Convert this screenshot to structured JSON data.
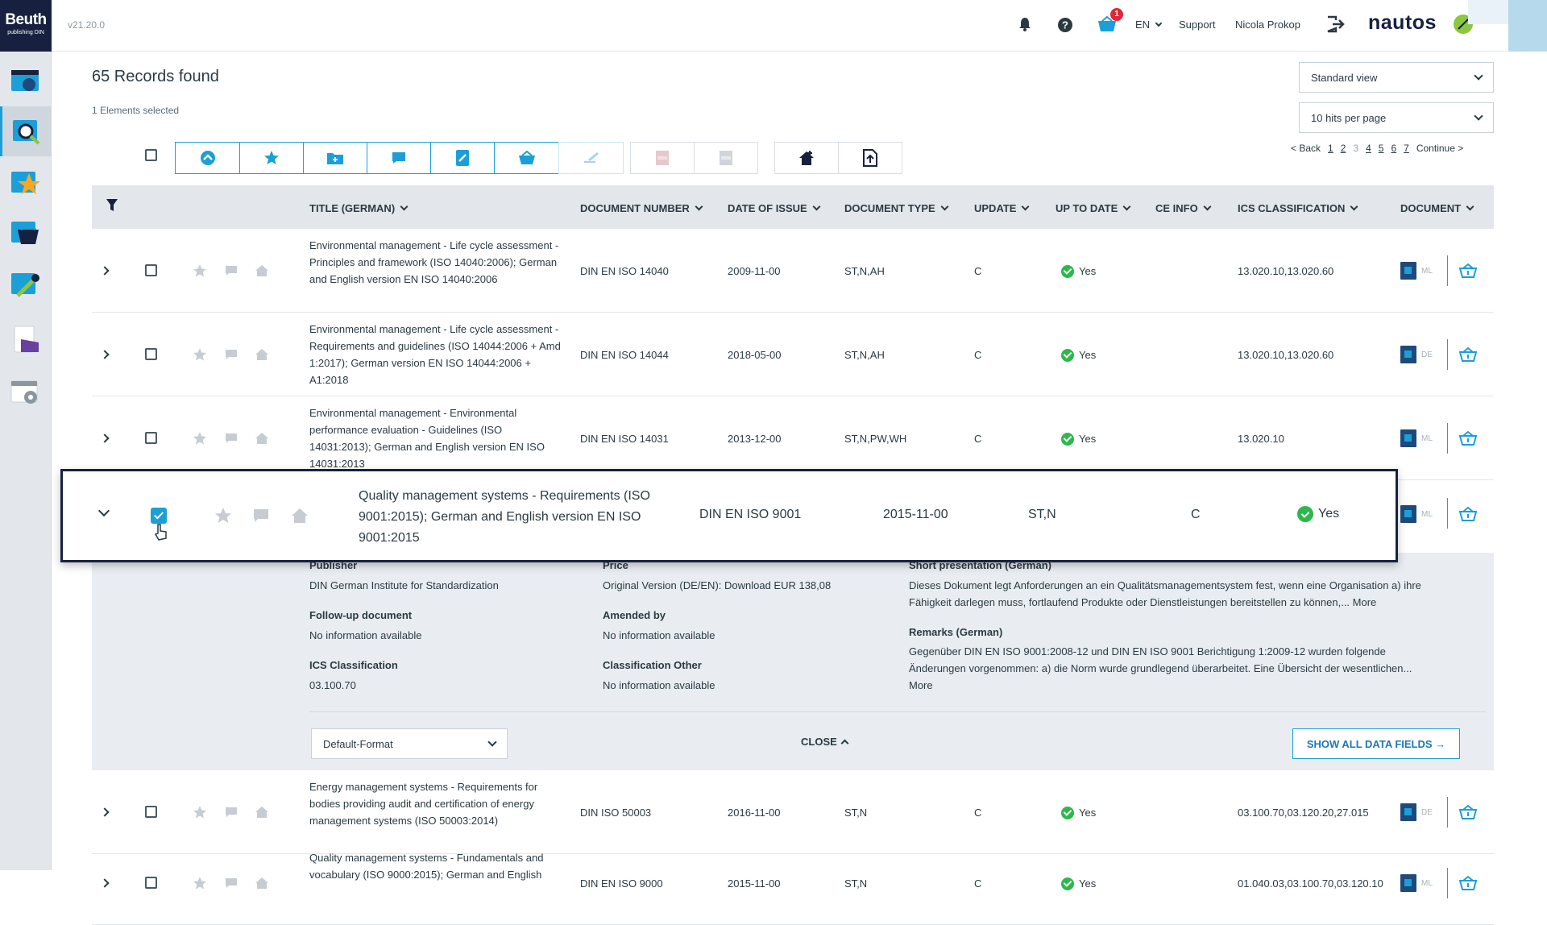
{
  "app": {
    "logo_line1": "Beuth",
    "logo_line2": "publishing DIN",
    "version": "v21.20.0",
    "brand": "nautos"
  },
  "sidebar": {
    "items": [
      {
        "name": "dashboard-icon"
      },
      {
        "name": "search-icon"
      },
      {
        "name": "favorites-icon"
      },
      {
        "name": "basket-icon"
      },
      {
        "name": "tools-icon"
      },
      {
        "name": "documents-icon"
      },
      {
        "name": "settings-icon"
      }
    ]
  },
  "header": {
    "cart_badge": "1",
    "language": "EN",
    "support": "Support",
    "user": "Nicola Prokop"
  },
  "results": {
    "count_label": "65 Records found",
    "selected_label": "1 Elements selected"
  },
  "controls": {
    "view": "Standard view",
    "per_page": "10 hits per page"
  },
  "pagination": {
    "back": "< Back",
    "pages": [
      "1",
      "2",
      "3",
      "4",
      "5",
      "6",
      "7"
    ],
    "continue": "Continue >"
  },
  "columns": [
    "TITLE (GERMAN)",
    "DOCUMENT NUMBER",
    "DATE OF ISSUE",
    "DOCUMENT TYPE",
    "UPDATE",
    "UP TO DATE",
    "CE INFO",
    "ICS CLASSIFICATION",
    "DOCUMENT"
  ],
  "rows": [
    {
      "title": "Environmental management - Life cycle assessment - Principles and framework (ISO 14040:2006); German and English version EN ISO 14040:2006",
      "number": "DIN EN ISO 14040",
      "date": "2009-11-00",
      "type": "ST,N,AH",
      "update": "C",
      "uptodate": "Yes",
      "ics": "13.020.10,13.020.60",
      "lang": "ML"
    },
    {
      "title": "Environmental management - Life cycle assessment - Requirements and guidelines (ISO 14044:2006 + Amd 1:2017); German version EN ISO 14044:2006 + A1:2018",
      "number": "DIN EN ISO 14044",
      "date": "2018-05-00",
      "type": "ST,N,AH",
      "update": "C",
      "uptodate": "Yes",
      "ics": "13.020.10,13.020.60",
      "lang": "DE"
    },
    {
      "title": "Environmental management - Environmental performance evaluation - Guidelines (ISO 14031:2013); German and English version EN ISO 14031:2013",
      "number": "DIN EN ISO 14031",
      "date": "2013-12-00",
      "type": "ST,N,PW,WH",
      "update": "C",
      "uptodate": "Yes",
      "ics": "13.020.10",
      "lang": "ML"
    }
  ],
  "expanded": {
    "title": "Quality management systems - Requirements (ISO 9001:2015); German and English version EN ISO 9001:2015",
    "number": "DIN EN ISO 9001",
    "date": "2015-11-00",
    "type": "ST,N",
    "update": "C",
    "uptodate": "Yes",
    "lang": "ML",
    "details": {
      "publisher_label": "Publisher",
      "publisher": "DIN German Institute for Standardization",
      "price_label": "Price",
      "price": "Original Version (DE/EN): Download EUR 138,08",
      "short_label": "Short presentation (German)",
      "short": "Dieses Dokument legt Anforderungen an ein Qualitätsmanagementsystem fest, wenn eine Organisation a) ihre Fähigkeit darlegen muss, fortlaufend Produkte oder Dienstleistungen bereitstellen zu können,... More",
      "followup_label": "Follow-up document",
      "followup": "No information available",
      "amended_label": "Amended by",
      "amended": "No information available",
      "remarks_label": "Remarks (German)",
      "remarks": "Gegenüber DIN EN ISO 9001:2008-12 und DIN EN ISO 9001 Berichtigung 1:2009-12 wurden folgende Änderungen vorgenommen: a) die Norm wurde grundlegend überarbeitet. Eine Übersicht der wesentlichen... More",
      "ics_label": "ICS Classification",
      "ics": "03.100.70",
      "classother_label": "Classification Other",
      "classother": "No information available",
      "format": "Default-Format",
      "close": "CLOSE",
      "show_all": "SHOW ALL DATA FIELDS →"
    }
  },
  "rows_after": [
    {
      "title": "Energy management systems - Requirements for bodies providing audit and certification of energy management systems (ISO 50003:2014)",
      "number": "DIN ISO 50003",
      "date": "2016-11-00",
      "type": "ST,N",
      "update": "C",
      "uptodate": "Yes",
      "ics": "03.100.70,03.120.20,27.015",
      "lang": "DE"
    },
    {
      "title": "Quality management systems - Fundamentals and vocabulary (ISO 9000:2015); German and English",
      "number": "DIN EN ISO 9000",
      "date": "2015-11-00",
      "type": "ST,N",
      "update": "C",
      "uptodate": "Yes",
      "ics": "01.040.03,03.100.70,03.120.10",
      "lang": "ML"
    }
  ],
  "colors": {
    "accent": "#1b9fd8",
    "navy": "#17213f",
    "ok": "#2db84c"
  }
}
